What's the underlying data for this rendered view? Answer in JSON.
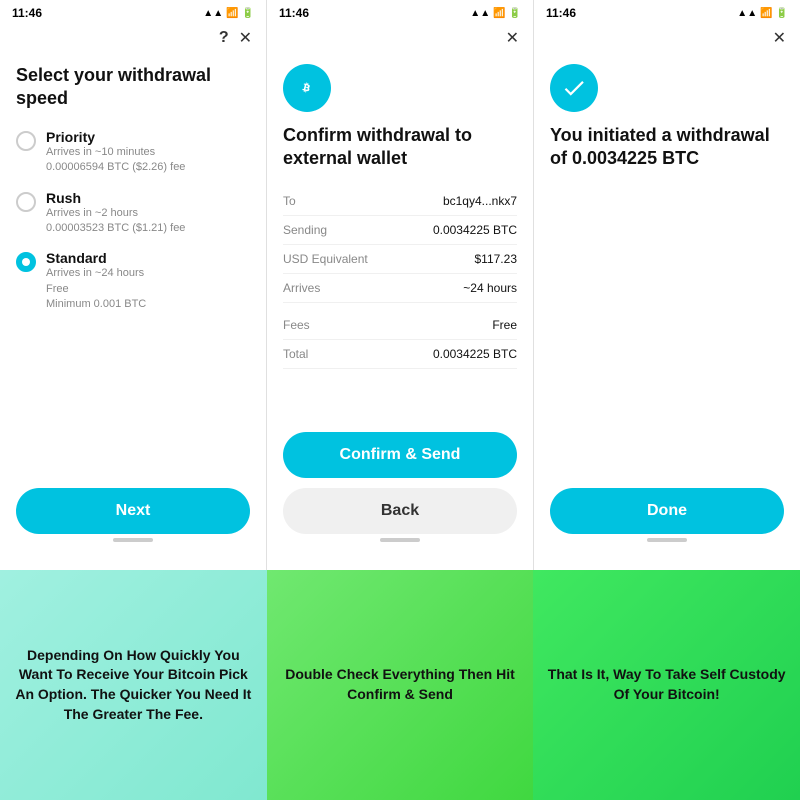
{
  "screens": [
    {
      "id": "screen1",
      "status_time": "11:46",
      "header": {
        "has_question": true,
        "has_close": true,
        "question_label": "?",
        "close_label": "✕"
      },
      "title": "Select your withdrawal speed",
      "options": [
        {
          "id": "priority",
          "name": "Priority",
          "desc_line1": "Arrives in ~10 minutes",
          "desc_line2": "0.00006594 BTC ($2.26) fee",
          "selected": false
        },
        {
          "id": "rush",
          "name": "Rush",
          "desc_line1": "Arrives in ~2 hours",
          "desc_line2": "0.00003523 BTC ($1.21) fee",
          "selected": false
        },
        {
          "id": "standard",
          "name": "Standard",
          "desc_line1": "Arrives in ~24 hours",
          "desc_line2": "Free",
          "desc_line3": "Minimum 0.001 BTC",
          "selected": true
        }
      ],
      "button_label": "Next"
    },
    {
      "id": "screen2",
      "status_time": "11:46",
      "header": {
        "has_close": true,
        "close_label": "✕"
      },
      "title": "Confirm withdrawal to external wallet",
      "details": [
        {
          "label": "To",
          "value": "bc1qy4...nkx7"
        },
        {
          "label": "Sending",
          "value": "0.0034225 BTC"
        },
        {
          "label": "USD Equivalent",
          "value": "$117.23"
        },
        {
          "label": "Arrives",
          "value": "~24 hours"
        }
      ],
      "details2": [
        {
          "label": "Fees",
          "value": "Free"
        },
        {
          "label": "Total",
          "value": "0.0034225 BTC"
        }
      ],
      "confirm_button": "Confirm & Send",
      "back_button": "Back"
    },
    {
      "id": "screen3",
      "status_time": "11:46",
      "header": {
        "has_close": true,
        "close_label": "✕"
      },
      "title": "You initiated a withdrawal of 0.0034225 BTC",
      "done_button": "Done"
    }
  ],
  "captions": [
    {
      "text": "Depending On How Quickly You Want To Receive Your Bitcoin Pick An Option. The Quicker You Need It The Greater The Fee."
    },
    {
      "text": "Double Check Everything Then Hit Confirm & Send"
    },
    {
      "text": "That Is It, Way To Take Self Custody Of Your Bitcoin!"
    }
  ]
}
